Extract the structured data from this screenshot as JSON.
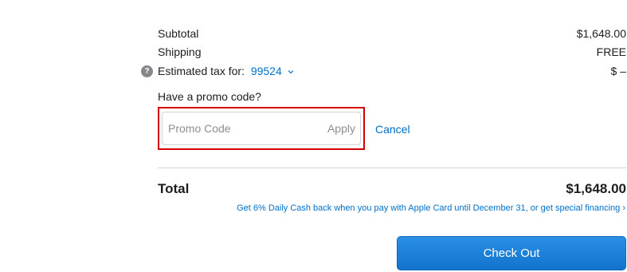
{
  "summary": {
    "subtotal_label": "Subtotal",
    "subtotal_value": "$1,648.00",
    "shipping_label": "Shipping",
    "shipping_value": "FREE",
    "tax_label": "Estimated tax for:",
    "tax_zip": "99524",
    "tax_value": "$ –",
    "help_icon": "question-mark-icon",
    "help_glyph": "?"
  },
  "promo": {
    "question": "Have a promo code?",
    "placeholder": "Promo Code",
    "value": "",
    "apply_label": "Apply",
    "cancel_label": "Cancel"
  },
  "total": {
    "label": "Total",
    "value": "$1,648.00",
    "cash_back_text": "Get 6% Daily Cash back when you pay with Apple Card until December 31, or get special financing ›"
  },
  "checkout": {
    "label": "Check Out"
  },
  "colors": {
    "link": "#0070c9",
    "highlight_border": "#d40000",
    "button": "#1a7fd8",
    "text": "#1d1d1f"
  }
}
